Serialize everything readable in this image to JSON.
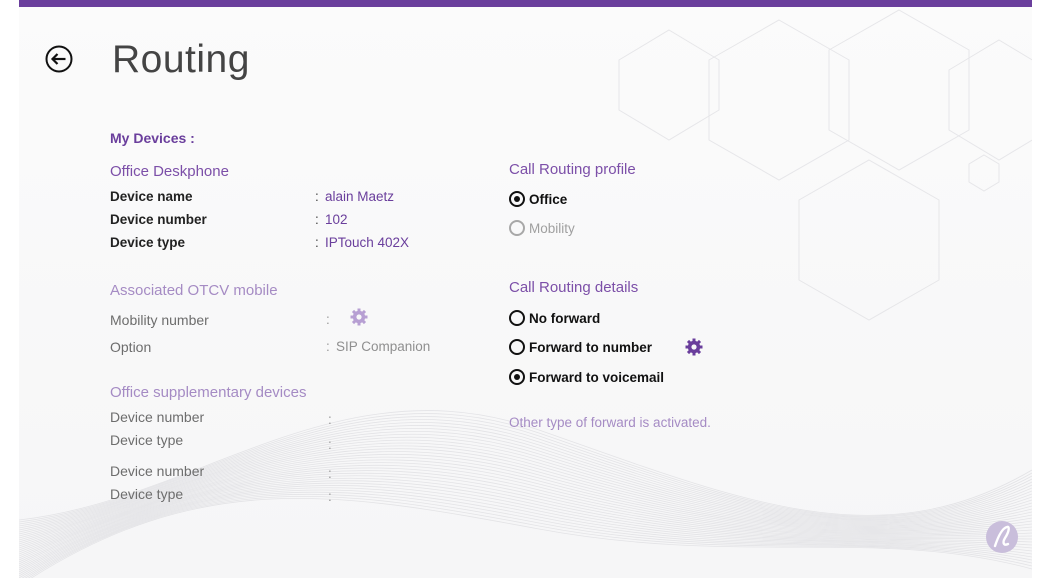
{
  "page": {
    "title": "Routing"
  },
  "my_devices": {
    "heading": "My Devices :"
  },
  "office_deskphone": {
    "title": "Office Deskphone",
    "rows": [
      {
        "label": "Device name",
        "value": "alain Maetz"
      },
      {
        "label": "Device number",
        "value": "102"
      },
      {
        "label": "Device type",
        "value": "IPTouch 402X"
      }
    ]
  },
  "otcv_mobile": {
    "title": "Associated OTCV mobile",
    "rows": [
      {
        "label": "Mobility number",
        "value": ""
      },
      {
        "label": "Option",
        "value": "SIP Companion"
      }
    ]
  },
  "supplementary": {
    "title": "Office supplementary devices",
    "rows": [
      {
        "label": "Device number",
        "value": ""
      },
      {
        "label": "Device type",
        "value": ""
      },
      {
        "label": "Device number",
        "value": ""
      },
      {
        "label": "Device type",
        "value": ""
      }
    ]
  },
  "colon": ":",
  "profile": {
    "title": "Call Routing profile",
    "options": [
      {
        "label": "Office",
        "checked": true,
        "enabled": true
      },
      {
        "label": "Mobility",
        "checked": false,
        "enabled": false
      }
    ]
  },
  "details": {
    "title": "Call Routing details",
    "options": [
      {
        "label": "No forward",
        "checked": false
      },
      {
        "label": "Forward to number",
        "checked": false
      },
      {
        "label": "Forward to voicemail",
        "checked": true
      }
    ],
    "note": "Other type of forward is activated."
  },
  "colors": {
    "accent": "#6a3e9c",
    "accent_light": "#a58bc4",
    "topbar": "#6a3e9c"
  },
  "icons": {
    "back": "back-arrow-circle-icon",
    "gear": "gear-icon",
    "logo": "brand-logo-icon"
  }
}
